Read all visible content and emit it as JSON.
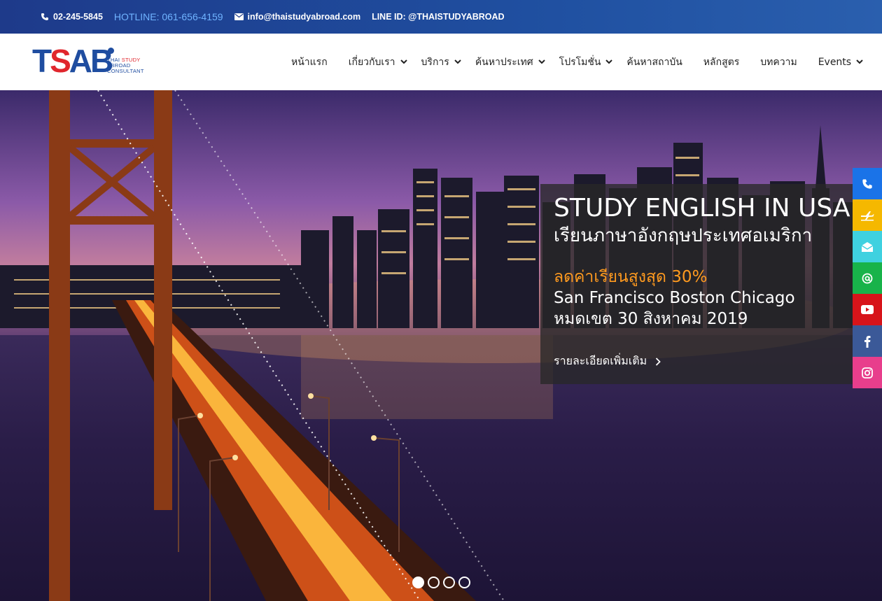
{
  "topbar": {
    "phone": "02-245-5845",
    "hotline": "HOTLINE: 061-656-4159",
    "email": "info@thaistudyabroad.com",
    "line_id": "LINE ID: @THAISTUDYABROAD"
  },
  "logo": {
    "mark_t": "T",
    "mark_s": "S",
    "mark_ab": "AB",
    "sub_line1_a": "THAI",
    "sub_line1_b": "STUDY",
    "sub_line2": "ABROAD",
    "sub_line3": "CONSULTANT"
  },
  "nav": {
    "items": [
      {
        "label": "หน้าแรก"
      },
      {
        "label": "เกี่ยวกับเรา"
      },
      {
        "label": "บริการ"
      },
      {
        "label": "ค้นหาประเทศ"
      },
      {
        "label": "โปรโมชั่น"
      },
      {
        "label": "ค้นหาสถาบัน"
      },
      {
        "label": "หลักสูตร"
      },
      {
        "label": "บทความ"
      },
      {
        "label": "Events"
      }
    ]
  },
  "hero": {
    "title": "STUDY ENGLISH IN USA",
    "subtitle": "เรียนภาษาอังกฤษประเทศอเมริกา",
    "promo": "ลดค่าเรียนสูงสุด 30%",
    "cities": "San Francisco Boston Chicago",
    "deadline": "หมดเขต 30 สิงหาคม 2019",
    "more": "รายละเอียดเพิ่มเติม"
  },
  "slider": {
    "total": 4,
    "active": 1
  },
  "social": {
    "items": [
      {
        "icon": "phone-icon",
        "color": "#1a73e8"
      },
      {
        "icon": "plane-icon",
        "color": "#f5b800"
      },
      {
        "icon": "envelope-open-icon",
        "color": "#3fd1e0"
      },
      {
        "icon": "at-icon",
        "color": "#18b34a"
      },
      {
        "icon": "youtube-icon",
        "color": "#d7141a"
      },
      {
        "icon": "facebook-icon",
        "color": "#3b5998"
      },
      {
        "icon": "instagram-icon",
        "color": "#e83e8c"
      }
    ]
  },
  "colors": {
    "topbar": "#1e3a8a",
    "brand_blue": "#1f4da0",
    "brand_red": "#e0262d",
    "promo_orange": "#ff9a1f",
    "hotline_blue": "#6fb3ff"
  }
}
